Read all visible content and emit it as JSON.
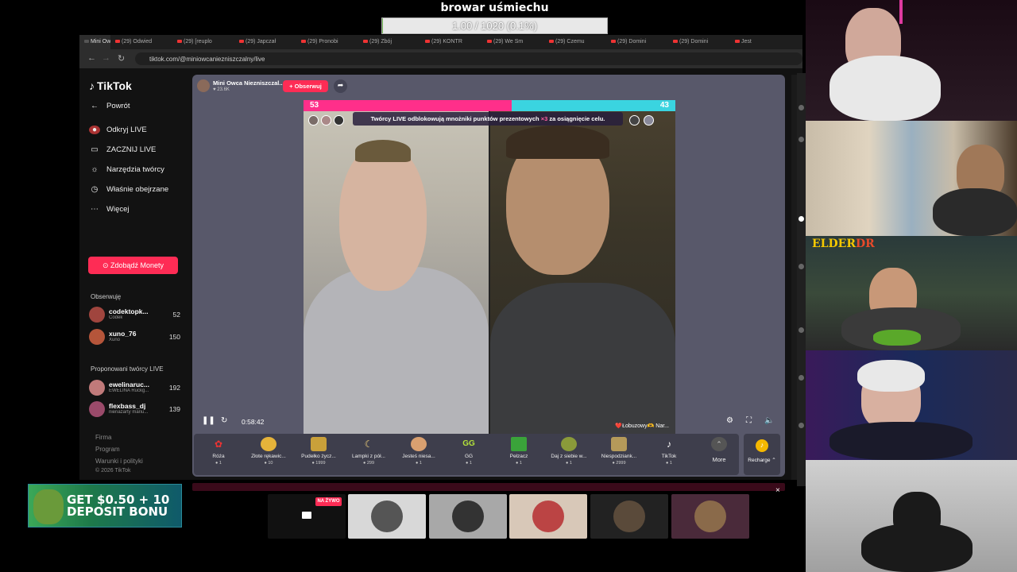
{
  "overlay": {
    "title": "browar uśmiechu",
    "progress_text": "1.00 / 1020 (0.1%)",
    "progress_fraction": 0.001
  },
  "browser": {
    "tabs": [
      "Mini Ow",
      "(29) Odwied",
      "(29) [reuplo",
      "(29) Japczał",
      "(29) Pronobi",
      "(29) Zbój",
      "(29) KONTR",
      "(29) We Sm",
      "(29) Czemu",
      "(29) Domini",
      "(29) Domini",
      "Jest"
    ],
    "url": "tiktok.com/@miniowcaniezniszczalny/live"
  },
  "sidebar": {
    "logo": "TikTok",
    "back": "Powrót",
    "items": [
      {
        "label": "Odkryj LIVE",
        "icon": "live-icon"
      },
      {
        "label": "ZACZNIJ LIVE",
        "icon": "camera-icon"
      },
      {
        "label": "Narzędzia twórcy",
        "icon": "lightbulb-icon"
      },
      {
        "label": "Właśnie obejrzane",
        "icon": "history-icon"
      },
      {
        "label": "Więcej",
        "icon": "more-icon"
      }
    ],
    "coins_button": "Zdobądź Monety",
    "following_label": "Obserwuję",
    "following": [
      {
        "name": "codektopk...",
        "sub": "Codek",
        "count": "52"
      },
      {
        "name": "xuno_76",
        "sub": "Xuno",
        "count": "150"
      }
    ],
    "suggested_label": "Proponowani twórcy LIVE",
    "suggested": [
      {
        "name": "ewelinaruc...",
        "sub": "EWELINA Ruckg...",
        "count": "192"
      },
      {
        "name": "flexbass_dj",
        "sub": "nienażarty mariu...",
        "count": "139"
      }
    ],
    "footer": [
      "Firma",
      "Program",
      "Warunki i polityki",
      "© 2026 TikTok"
    ]
  },
  "live": {
    "host_name": "Mini Owca Niezniszczal...",
    "likes": "23.6K",
    "follow_label": "+ Obserwuj",
    "score_left": "53",
    "score_right": "43",
    "banner_text": "Twórcy LIVE odblokowują mnożniki punktów prezentowych",
    "banner_mult": "×3",
    "banner_tail": "za osiągnięcie celu.",
    "right_tag": "❤️Łobuzowy🫶 Nar...",
    "time": "0:58:42",
    "gifts": [
      {
        "name": "Róża",
        "price": "1",
        "icon": "rose-icon"
      },
      {
        "name": "Złote rękawic...",
        "price": "10",
        "icon": "glove-icon"
      },
      {
        "name": "Pudełko życz...",
        "price": "1999",
        "icon": "box-icon"
      },
      {
        "name": "Lampki z pół...",
        "price": "299",
        "icon": "lamp-icon"
      },
      {
        "name": "Jesteś niesa...",
        "price": "1",
        "icon": "cat-icon"
      },
      {
        "name": "GG",
        "price": "1",
        "icon": "gg-icon"
      },
      {
        "name": "Pełzacz",
        "price": "1",
        "icon": "creeper-icon"
      },
      {
        "name": "Daj z siebie w...",
        "price": "1",
        "icon": "ball-icon"
      },
      {
        "name": "Niespodziank...",
        "price": "2999",
        "icon": "surprise-icon"
      },
      {
        "name": "TikTok",
        "price": "1",
        "icon": "tiktok-icon"
      }
    ],
    "more_label": "More",
    "recharge_label": "Recharge"
  },
  "bottom": {
    "live_badge": "NA ŻYWO"
  },
  "ad": {
    "line1": "GET $0.50 + 10",
    "line2": "DEPOSIT BONU"
  },
  "webcams": {
    "elder_logo_a": "ELDER",
    "elder_logo_b": "DR"
  }
}
